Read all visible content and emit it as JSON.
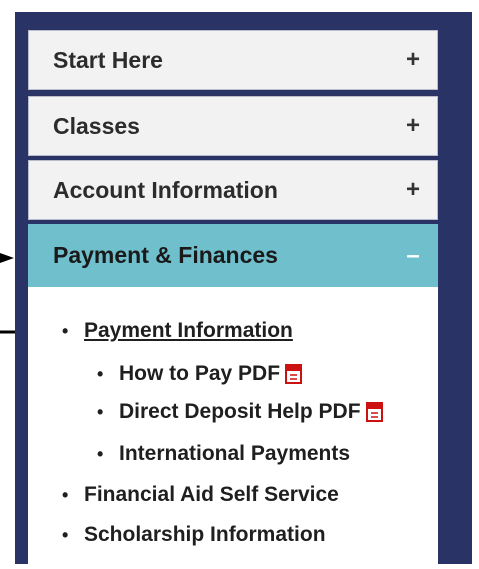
{
  "accordion": {
    "items": [
      {
        "label": "Start Here",
        "toggle": "+"
      },
      {
        "label": "Classes",
        "toggle": "+"
      },
      {
        "label": "Account Information",
        "toggle": "+"
      },
      {
        "label": "Payment & Finances",
        "toggle": "–"
      }
    ]
  },
  "menu": {
    "payment_information": "Payment Information",
    "how_to_pay": "How to Pay PDF",
    "direct_deposit": "Direct Deposit Help PDF",
    "international_payments": "International Payments",
    "financial_aid": "Financial Aid Self Service",
    "scholarship": "Scholarship Information",
    "bullet": "•"
  },
  "colors": {
    "panel": "#293365",
    "item_bg": "#f2f2f2",
    "active_bg": "#6fbfcd",
    "pdf_icon": "#cc1111"
  },
  "icons": [
    "pdf-icon",
    "arrow-right-icon"
  ]
}
